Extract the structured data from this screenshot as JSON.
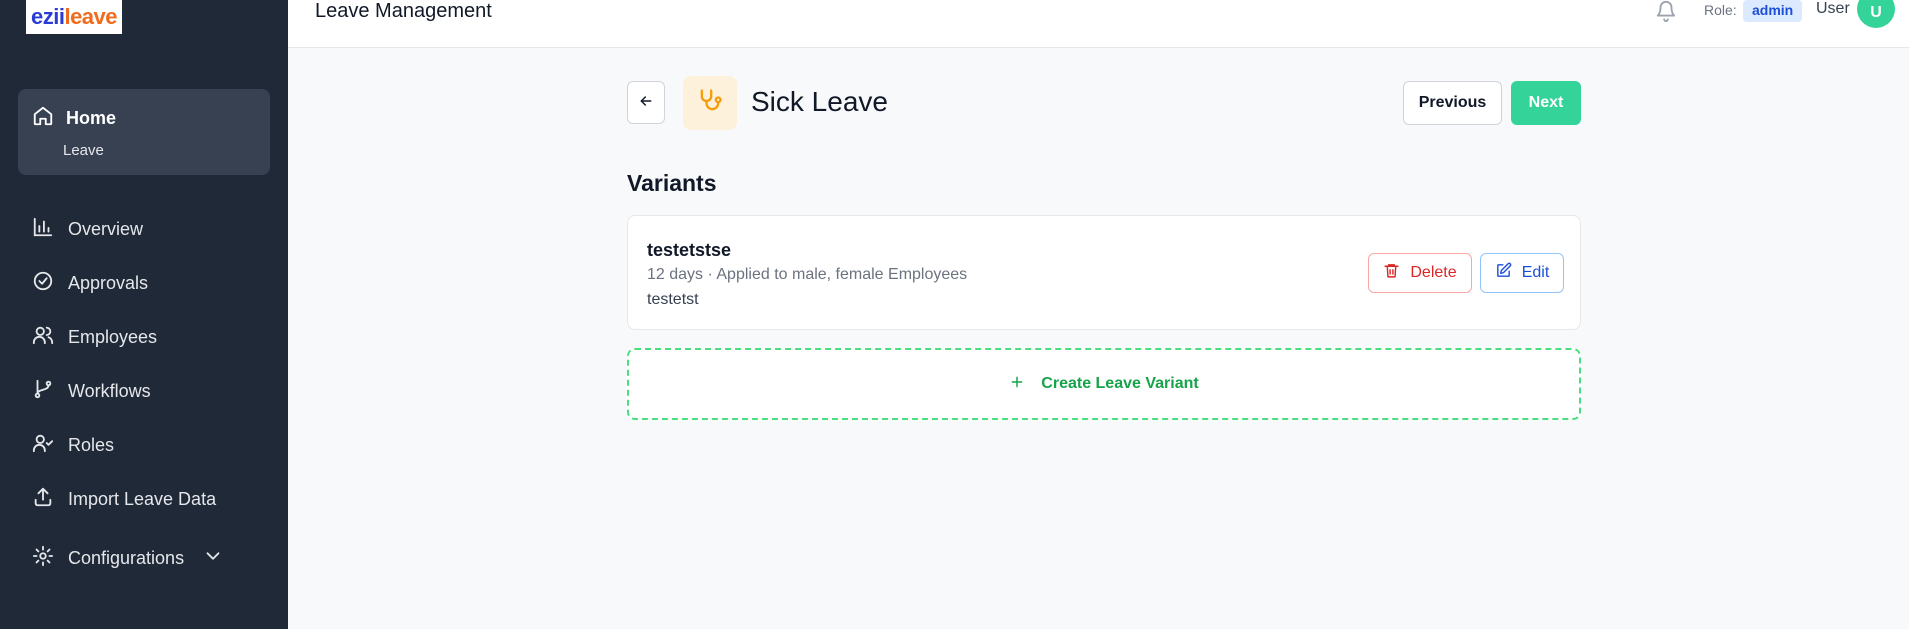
{
  "app": {
    "logo_part1": "ezii",
    "logo_part2": "leave"
  },
  "sidebar": {
    "home": {
      "label": "Home",
      "icon": "home-icon",
      "sub_label": "Leave"
    },
    "items": [
      {
        "label": "Overview",
        "icon": "bar-chart-icon"
      },
      {
        "label": "Approvals",
        "icon": "check-circle-icon"
      },
      {
        "label": "Employees",
        "icon": "users-icon"
      },
      {
        "label": "Workflows",
        "icon": "git-branch-icon"
      },
      {
        "label": "Roles",
        "icon": "user-check-icon"
      },
      {
        "label": "Import Leave Data",
        "icon": "upload-icon"
      },
      {
        "label": "Configurations",
        "icon": "gear-icon"
      }
    ]
  },
  "header": {
    "title": "Leave Management",
    "role_label": "Role:",
    "role_value": "admin",
    "user_label": "User",
    "avatar_initial": "U"
  },
  "main": {
    "title": "Sick Leave",
    "type_icon": "stethoscope-icon",
    "previous_label": "Previous",
    "next_label": "Next",
    "section_title": "Variants",
    "variants": [
      {
        "name": "testetstse",
        "meta": "12 days · Applied to male, female Employees",
        "description": "testetst",
        "delete_label": "Delete",
        "edit_label": "Edit"
      }
    ],
    "create_label": "Create Leave Variant"
  },
  "colors": {
    "sidebar_bg": "#1f2937",
    "accent_green": "#34d399",
    "delete_red": "#dc2626",
    "edit_blue": "#1d4ed8",
    "leave_icon_orange": "#f59e0b"
  }
}
